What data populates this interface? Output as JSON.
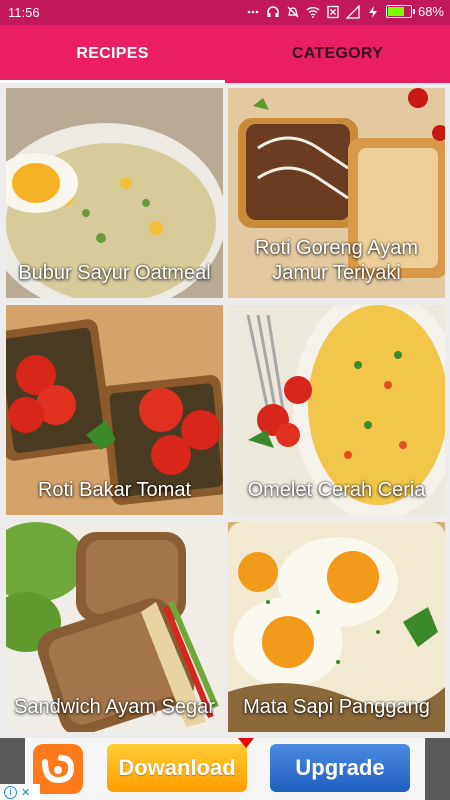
{
  "status_bar": {
    "time": "11:56",
    "battery_percent": "68%",
    "battery_level": 0.68,
    "icons": [
      "more-icon",
      "headset-icon",
      "mute-icon",
      "wifi-icon",
      "sim-icon",
      "signal-icon",
      "charging-icon",
      "battery-icon"
    ]
  },
  "tabs": [
    {
      "label": "RECIPES",
      "active": true
    },
    {
      "label": "CATEGORY",
      "active": false
    }
  ],
  "recipes": [
    {
      "title": "Bubur Sayur Oatmeal"
    },
    {
      "title": "Roti Goreng Ayam Jamur Teriyaki"
    },
    {
      "title": "Roti Bakar Tomat"
    },
    {
      "title": "Omelet Cerah Ceria"
    },
    {
      "title": "Sandwich Ayam Segar"
    },
    {
      "title": "Mata Sapi Panggang"
    }
  ],
  "ad": {
    "download_label": "Dowanload",
    "upgrade_label": "Upgrade",
    "colors": {
      "download": "#ffb000",
      "upgrade": "#2a6fd0",
      "logo": "#ff7a1a"
    }
  },
  "theme": {
    "primary": "#e91e63",
    "primary_dark": "#c2185b"
  }
}
